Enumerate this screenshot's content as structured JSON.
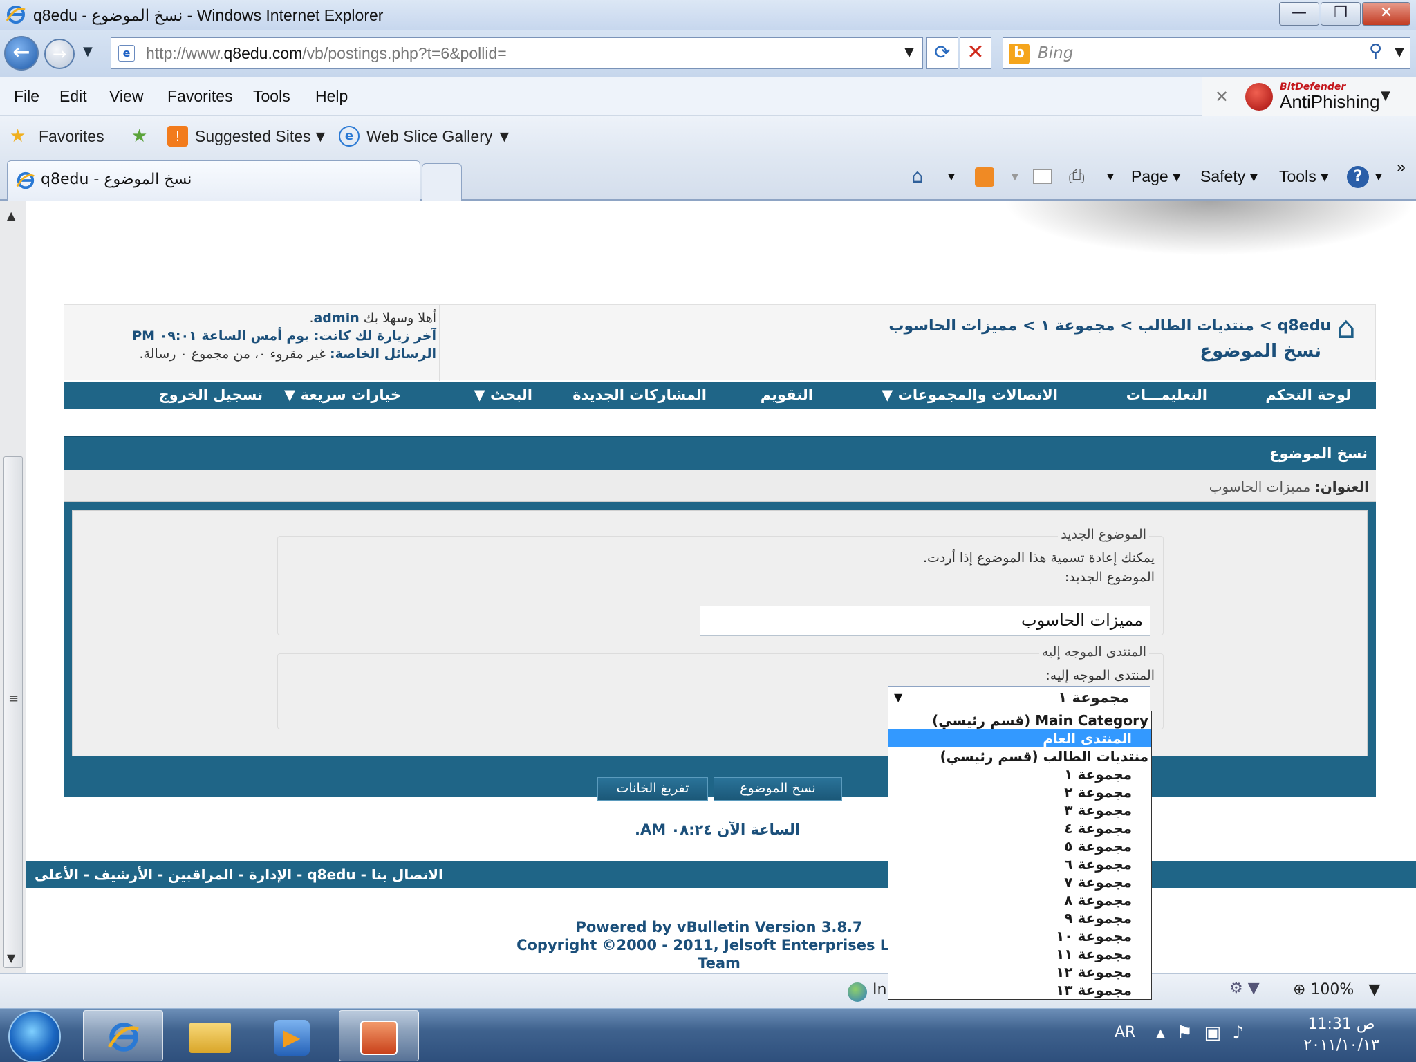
{
  "window": {
    "title": "q8edu - نسخ الموضوع - Windows Internet Explorer",
    "minimize": "—",
    "maximize": "❐",
    "close": "✕"
  },
  "address": {
    "url_prefix": "http://www.",
    "url_domain": "q8edu.com",
    "url_rest": "/vb/postings.php?t=6&pollid=",
    "search_placeholder": "Bing"
  },
  "menu": [
    "File",
    "Edit",
    "View",
    "Favorites",
    "Tools",
    "Help"
  ],
  "bitdefender": {
    "brand": "BitDefender",
    "name": "AntiPhishing"
  },
  "favorites_bar": {
    "favorites": "Favorites",
    "suggested": "Suggested Sites",
    "webslice": "Web Slice Gallery"
  },
  "tab": {
    "title": "q8edu - نسخ الموضوع"
  },
  "command_bar": {
    "page": "Page",
    "safety": "Safety",
    "tools": "Tools"
  },
  "forum": {
    "breadcrumb": "q8edu > منتديات الطالب > مجموعة ١ > مميزات الحاسوب",
    "page_title": "نسخ الموضوع",
    "welcome_line1_prefix": "أهلا وسهلا بك ",
    "username": "admin",
    "welcome_line2": "آخر زيارة لك كانت: يوم أمس الساعة ٠٩:٠١ PM",
    "welcome_line3_label": "الرسائل الخاصة:",
    "welcome_line3_text": " غير مقروء ٠، من مجموع ٠ رسالة.",
    "navbar": [
      "لوحة التحكم",
      "التعليمـــات",
      "الاتصالات والمجموعات",
      "التقويم",
      "المشاركات الجديدة",
      "البحث",
      "خيارات سريعة",
      "تسجيل الخروج"
    ],
    "panel_title": "نسخ الموضوع",
    "title_label": "العنوان:",
    "title_value": " مميزات الحاسوب",
    "new_topic_legend": "الموضوع الجديد",
    "new_topic_help": "يمكنك إعادة تسمية هذا الموضوع إذا أردت.",
    "new_topic_label": "الموضوع الجديد:",
    "new_topic_value": "مميزات الحاسوب",
    "dest_legend": "المنتدى الموجه إليه",
    "dest_label": "المنتدى الموجه إليه:",
    "dest_selected": "مجموعة ١",
    "btn_copy": "نسخ الموضوع",
    "btn_reset": "تفريغ الخانات",
    "time_now": "الساعة الآن ٠٨:٢٤ AM.",
    "footer_links": "الاتصال بنا - q8edu - الإدارة - المراقبين - الأرشيف - الأعلى",
    "powered_1": "Powered by vBulletin Version 3.8.7",
    "powered_2": "Copyright ©2000 - 2011, Jelsoft Enterprises Ltd T",
    "powered_3": "Team"
  },
  "dropdown_options": [
    {
      "label": "Main Category (قسم رئيسي)",
      "type": "category"
    },
    {
      "label": "المنتدى العام",
      "type": "forum",
      "selected": true
    },
    {
      "label": "منتديات الطالب (قسم رئيسي)",
      "type": "category"
    },
    {
      "label": "مجموعة ١",
      "type": "forum"
    },
    {
      "label": "مجموعة ٢",
      "type": "forum"
    },
    {
      "label": "مجموعة ٣",
      "type": "forum"
    },
    {
      "label": "مجموعة ٤",
      "type": "forum"
    },
    {
      "label": "مجموعة ٥",
      "type": "forum"
    },
    {
      "label": "مجموعة ٦",
      "type": "forum"
    },
    {
      "label": "مجموعة ٧",
      "type": "forum"
    },
    {
      "label": "مجموعة ٨",
      "type": "forum"
    },
    {
      "label": "مجموعة ٩",
      "type": "forum"
    },
    {
      "label": "مجموعة ١٠",
      "type": "forum"
    },
    {
      "label": "مجموعة ١١",
      "type": "forum"
    },
    {
      "label": "مجموعة ١٢",
      "type": "forum"
    },
    {
      "label": "مجموعة ١٣",
      "type": "forum"
    }
  ],
  "status": {
    "zone": "In",
    "zoom": "100%"
  },
  "taskbar": {
    "lang": "AR",
    "time": "11:31 ص",
    "date": "٢٠١١/١٠/١٣"
  },
  "icons": [
    "ie-icon",
    "back-icon",
    "forward-icon",
    "refresh-icon",
    "stop-icon",
    "search-icon",
    "star-icon",
    "home-icon",
    "feed-icon",
    "mail-icon",
    "print-icon",
    "help-icon",
    "start-orb-icon"
  ],
  "colors": {
    "forum_blue": "#1f6587",
    "link_blue": "#1b4f7a",
    "selected": "#3399ff"
  }
}
